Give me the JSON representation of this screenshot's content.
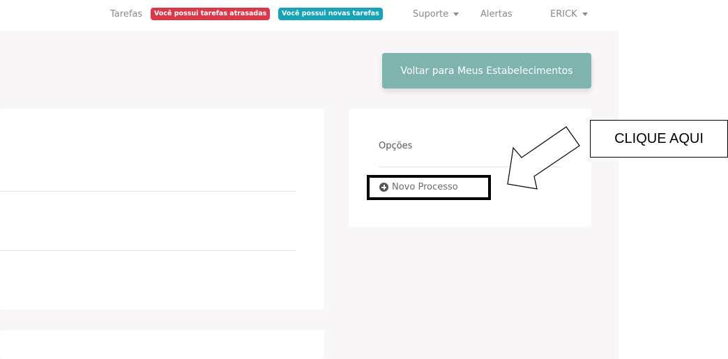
{
  "nav": {
    "tasks_label": "Tarefas",
    "badge_overdue": "Você possui tarefas atrasadas",
    "badge_new": "Você possui novas tarefas",
    "support_label": "Suporte",
    "alerts_label": "Alertas",
    "user_label": "ERICK"
  },
  "actions": {
    "back_label": "Voltar para Meus Estabelecimentos"
  },
  "options": {
    "title": "Opções",
    "new_process_label": "Novo Processo"
  },
  "annotation": {
    "callout_text": "CLIQUE AQUI"
  },
  "colors": {
    "badge_overdue": "#d9394a",
    "badge_new": "#17a2b8",
    "back_button": "#7fb3ae",
    "page_bg": "#f8f6f7"
  }
}
